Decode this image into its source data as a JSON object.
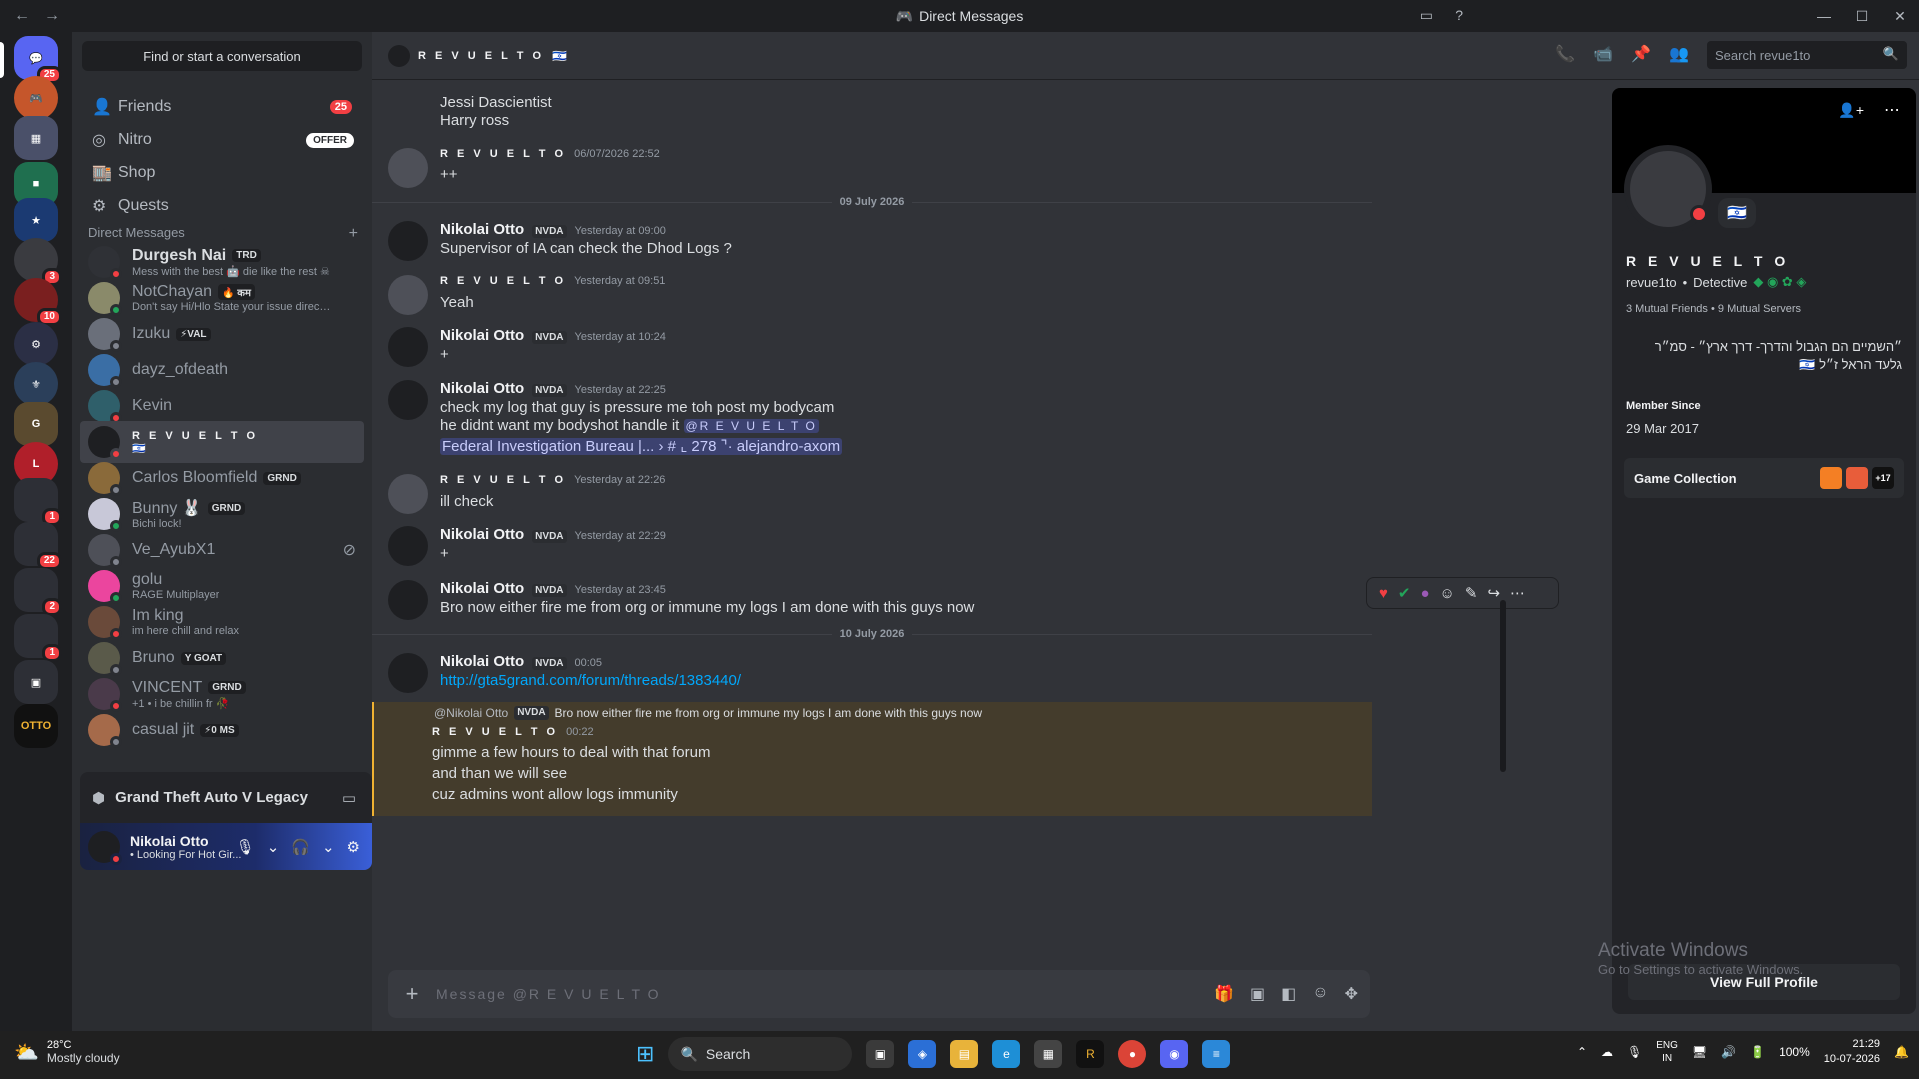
{
  "window": {
    "title": "Direct Messages"
  },
  "servers": {
    "dm_badge": "25",
    "badges": [
      "3",
      "10",
      "1",
      "22",
      "2",
      "1"
    ]
  },
  "sidebar": {
    "find_placeholder": "Find or start a conversation",
    "nav": [
      {
        "label": "Friends",
        "badge": "25"
      },
      {
        "label": "Nitro",
        "badge": "OFFER"
      },
      {
        "label": "Shop"
      },
      {
        "label": "Quests"
      }
    ],
    "dm_header": "Direct Messages",
    "dms": [
      {
        "name": "Durgesh Nai",
        "tag": "TRD",
        "sub": "Mess with the best 🤖 die like the rest ☠"
      },
      {
        "name": "NotChayan",
        "tag": "🔥 कम",
        "sub": "Don't say Hi/Hlo State your issue directly!!"
      },
      {
        "name": "Izuku",
        "tag": "⚡VAL",
        "sub": ""
      },
      {
        "name": "dayz_ofdeath",
        "tag": "",
        "sub": ""
      },
      {
        "name": "Kevin",
        "tag": "",
        "sub": ""
      },
      {
        "name": "R E V U E L T O",
        "tag": "",
        "sub": "🇮🇱"
      },
      {
        "name": "Carlos Bloomfield",
        "tag": "GRND",
        "sub": ""
      },
      {
        "name": "Bunny 🐰",
        "tag": "GRND",
        "sub": "Bichi lock!"
      },
      {
        "name": "Ve_AyubX1",
        "tag": "",
        "sub": ""
      },
      {
        "name": "golu",
        "tag": "",
        "sub": "RAGE Multiplayer"
      },
      {
        "name": "Im king",
        "tag": "",
        "sub": "im here chill and relax"
      },
      {
        "name": "Bruno",
        "tag": "Y GOAT",
        "sub": ""
      },
      {
        "name": "VINCENT",
        "tag": "GRND",
        "sub": "+1 • i be chillin fr 🥀"
      },
      {
        "name": "casual jit",
        "tag": "⚡0 MS",
        "sub": ""
      }
    ],
    "activity": "Grand Theft Auto V Legacy",
    "user": {
      "name": "Nikolai Otto",
      "status": "• Looking For Hot Gir..."
    }
  },
  "chat": {
    "header_name": "R E V U E L T O",
    "search_placeholder": "Search revue1to",
    "messages": [
      {
        "lines": [
          "Jessi Dascientist",
          "Harry ross"
        ]
      },
      {
        "author": "R E V U E L T O",
        "time": "06/07/2026 22:52",
        "lines": [
          "++"
        ]
      },
      {
        "divider": "09 July 2026"
      },
      {
        "author": "Nikolai Otto",
        "badge": "NVDA",
        "time": "Yesterday at 09:00",
        "lines": [
          "Supervisor of IA can check the Dhod Logs ?"
        ]
      },
      {
        "author": "R E V U E L T O",
        "time": "Yesterday at 09:51",
        "lines": [
          "Yeah"
        ]
      },
      {
        "author": "Nikolai Otto",
        "badge": "NVDA",
        "time": "Yesterday at 10:24",
        "lines": [
          "+"
        ]
      },
      {
        "author": "Nikolai Otto",
        "badge": "NVDA",
        "time": "Yesterday at 22:25",
        "lines": [
          "check my log that guy is pressure me toh post my bodycam",
          "he didnt want my bodyshot handle it"
        ],
        "mention": "@R E V U E L T O",
        "channel": "Federal Investigation Bureau |... › # ⌞ 278 ⌝· alejandro-axom"
      },
      {
        "author": "R E V U E L T O",
        "time": "Yesterday at 22:26",
        "lines": [
          "ill check"
        ]
      },
      {
        "author": "Nikolai Otto",
        "badge": "NVDA",
        "time": "Yesterday at 22:29",
        "lines": [
          "+"
        ]
      },
      {
        "author": "Nikolai Otto",
        "badge": "NVDA",
        "time": "Yesterday at 23:45",
        "lines": [
          "Bro now either fire me from org or immune my logs I am done with this guys now"
        ]
      },
      {
        "divider": "10 July 2026"
      },
      {
        "author": "Nikolai Otto",
        "badge": "NVDA",
        "time": "00:05",
        "lines": [
          "http://gta5grand.com/forum/threads/1383440/"
        ]
      },
      {
        "reply_to": "@Nikolai Otto",
        "reply_badge": "NVDA",
        "reply_text": "Bro now either fire me from org or immune my logs I am done with this guys now",
        "author": "R E V U E L T O",
        "time": "00:22",
        "lines": [
          "gimme a few hours to deal with that forum",
          "and than we will see",
          "cuz admins wont allow logs immunity"
        ]
      }
    ],
    "composer_placeholder": "Message @R E V U E L T O"
  },
  "profile": {
    "name": "R E V U E L T O",
    "username": "revue1to",
    "role": "Detective",
    "mutual": "3 Mutual Friends • 9 Mutual Servers",
    "bio": "״השמיים הם הגבול והדרך- דרך ארץ״ - סמ״ר גלעד הראל ז״ל 🇮🇱",
    "member_since_label": "Member Since",
    "member_since": "29 Mar 2017",
    "game_collection": "Game Collection",
    "game_extra": "+17",
    "view_full": "View Full Profile"
  },
  "watermark": {
    "line1": "Activate Windows",
    "line2": "Go to Settings to activate Windows."
  },
  "taskbar": {
    "temp": "28°C",
    "weather": "Mostly cloudy",
    "search": "Search",
    "lang": "ENG",
    "region": "IN",
    "battery": "100%",
    "time": "21:29",
    "date": "10-07-2026"
  },
  "colors": {
    "accent": "#5865f2",
    "online": "#23a55a",
    "dnd": "#f23f43",
    "highlight": "#f0b232"
  }
}
